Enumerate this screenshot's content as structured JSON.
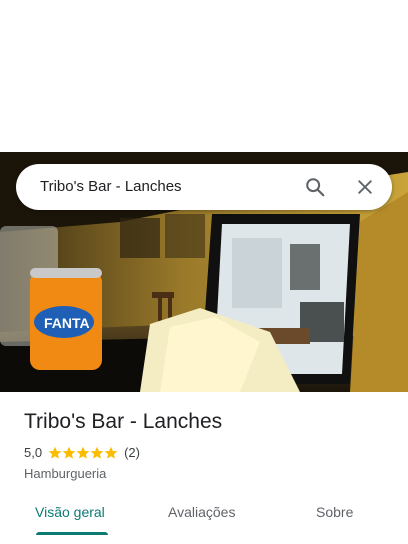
{
  "search": {
    "query": "Tribo's Bar - Lanches",
    "search_icon": "search-icon",
    "close_icon": "close-icon"
  },
  "place": {
    "name": "Tribo's Bar - Lanches",
    "rating": "5,0",
    "stars": 5,
    "reviews_count": "(2)",
    "category": "Hamburgueria"
  },
  "tabs": [
    {
      "label": "Visão geral",
      "active": true
    },
    {
      "label": "Avaliações",
      "active": false
    },
    {
      "label": "Sobre",
      "active": false
    }
  ],
  "colors": {
    "accent": "#0b7a75",
    "star": "#fbbc04"
  }
}
